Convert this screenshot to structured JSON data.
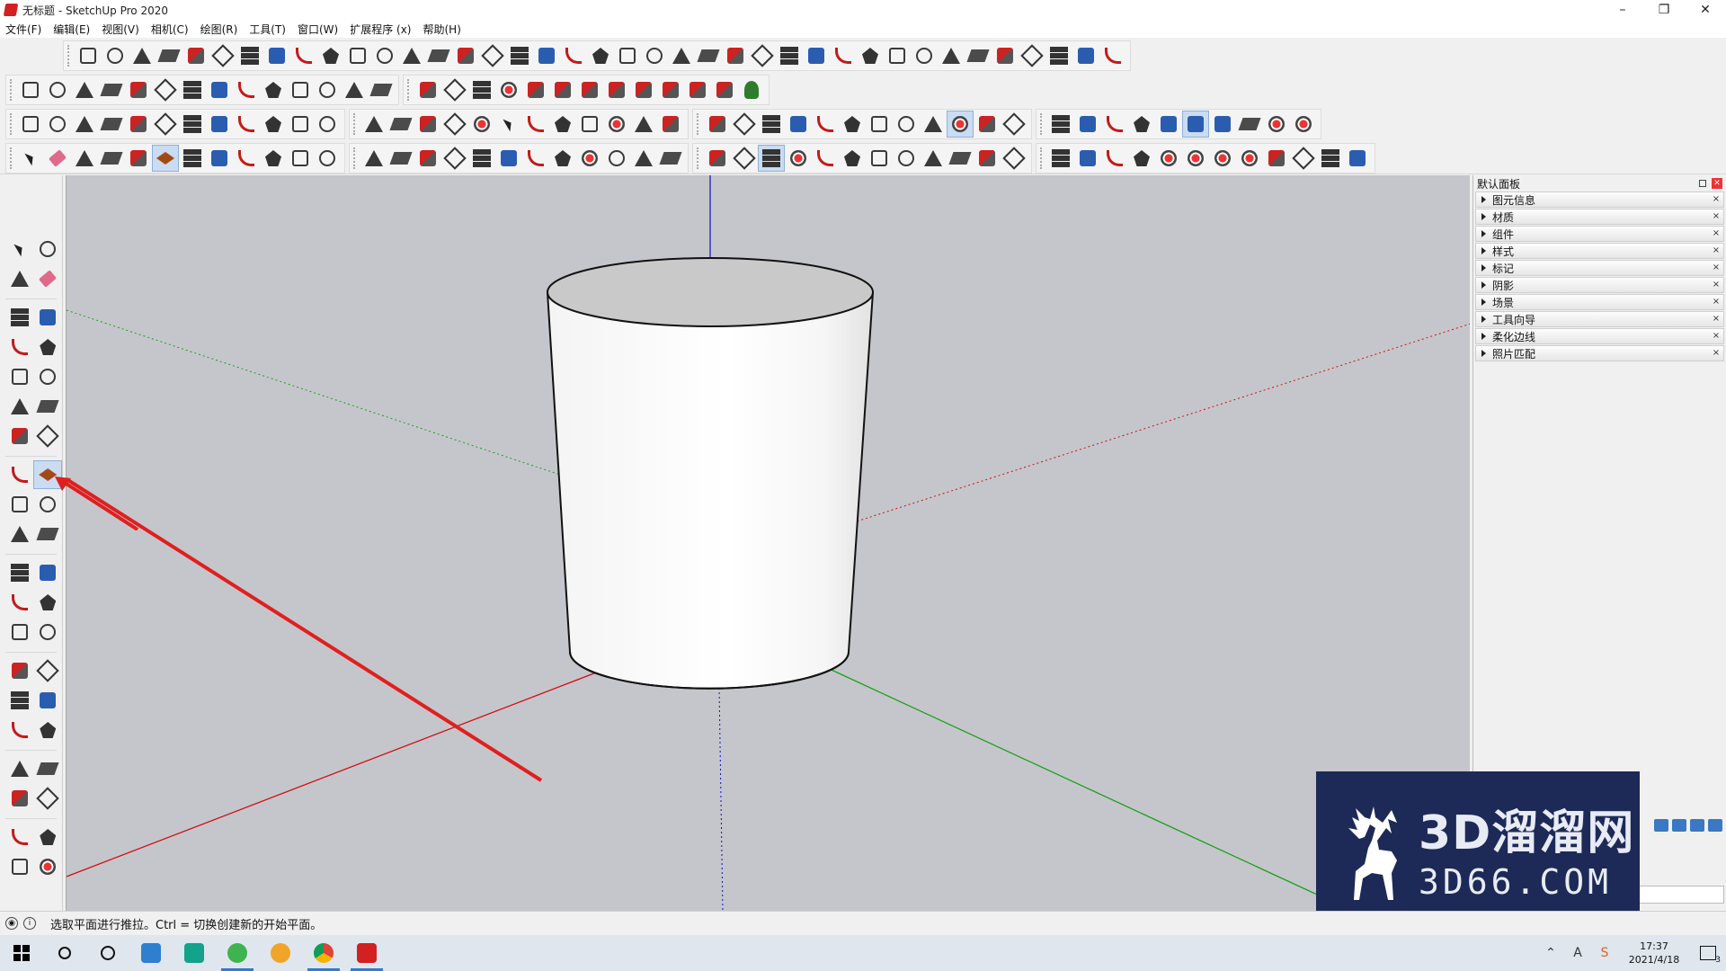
{
  "window": {
    "title": "无标题 - SketchUp Pro 2020",
    "minimize": "–",
    "restore": "❐",
    "close": "✕"
  },
  "menu": [
    "文件(F)",
    "编辑(E)",
    "视图(V)",
    "相机(C)",
    "绘图(R)",
    "工具(T)",
    "窗口(W)",
    "扩展程序 (x)",
    "帮助(H)"
  ],
  "toolbars": {
    "row1_icons": [
      "draw-icon",
      "polyline-icon",
      "shape-icon",
      "cut-icon",
      "gear-shape-icon",
      "bevel-icon",
      "sweep-icon",
      "box-icon",
      "sphere-icon",
      "curve-icon",
      "fillet-icon",
      "chamfer-icon",
      "offset-icon",
      "join-icon",
      "tube-icon",
      "cone-icon",
      "column-icon",
      "array-icon",
      "hand-icon",
      "extrude-icon",
      "path-icon",
      "loft-icon",
      "slice-icon",
      "skew-icon",
      "scale-icon",
      "mirror-icon",
      "stamp-icon",
      "solid-icon",
      "rail-icon",
      "grid-icon",
      "split-icon",
      "shell-icon",
      "fold-icon",
      "stairs-icon",
      "wall-icon",
      "twist-icon",
      "cage-icon",
      "lattice-icon",
      "building-icon"
    ],
    "row2_icons": [
      "bezier-icon",
      "spline-icon",
      "curve-draw-icon",
      "freehand-icon",
      "arc-ext-icon",
      "circle-ext-icon",
      "rect-ext-icon",
      "polygon-ext-icon",
      "ellipse-ext-icon",
      "arc3-icon",
      "zigzag-icon",
      "spiral-icon",
      "arcs-icon",
      "line-ext-icon",
      "loop-icon",
      "tool-icon",
      "circle-small-icon",
      "shape-red-icon",
      "push-red-icon",
      "push-e-icon",
      "push-r-icon",
      "push-v-icon",
      "push-n-icon",
      "push-x-icon",
      "push-f-icon",
      "push-magenta-icon",
      "tree-icon"
    ],
    "row3_icons": [
      "orbit-icon",
      "zoom-icon",
      "zoom-window-icon",
      "zoom-extents-icon",
      "zoom-prev-icon",
      "pan-icon",
      "walk-icon",
      "look-icon",
      "footprints-icon",
      "section-icon",
      "section-fill-icon",
      "box-view-icon",
      "table-icon",
      "grid-view-icon",
      "rail-view-icon",
      "line-view-icon",
      "move-red-icon",
      "select-pointer-icon",
      "check-icon",
      "paint-view-icon",
      "diamond-icon",
      "cube-red-icon",
      "pin-icon",
      "push-down-icon",
      "follow-icon",
      "wave-icon",
      "dup-icon",
      "layer-icon",
      "copy-icon",
      "wall-view-icon",
      "knife-icon",
      "key-icon",
      "3b-icon",
      "red-disk-icon",
      "su-app-icon",
      "stack-icon",
      "stack2-icon",
      "stack3-icon",
      "stack4-icon",
      "axes-icon",
      "blue-cube-icon",
      "blue-cube2-icon",
      "blue-cube3-icon",
      "undo-view-icon",
      "ruby-icon",
      "ruby2-icon"
    ],
    "row4_icons": [
      "select-icon",
      "eraser-icon",
      "pencil-icon",
      "arc-icon",
      "circle-icon",
      "push-pull-icon",
      "follow-me-icon",
      "move-icon",
      "rotate-icon",
      "scale-icon",
      "tape-icon",
      "text-icon",
      "paint-icon",
      "orbit-icon",
      "pan-icon",
      "zoom-icon",
      "zoom-extents-icon",
      "warehouse-icon",
      "extension-icon",
      "share-icon",
      "ruby-gem-icon",
      "user-icon",
      "face-style-icon",
      "xray-icon",
      "wireframe-icon",
      "hidden-line-icon",
      "shaded-icon",
      "textured-icon",
      "monochrome-icon",
      "iso-icon",
      "top-icon",
      "front-icon",
      "right-icon",
      "back-icon",
      "left-icon",
      "group1-icon",
      "group2-icon",
      "group3-icon",
      "group4-icon",
      "group5-icon",
      "red1-icon",
      "red2-icon",
      "red3-icon",
      "red4-icon",
      "arc-style-icon",
      "shield-icon",
      "sandbox-icon",
      "terrain-icon"
    ]
  },
  "left_tools": [
    [
      "select-icon",
      "component-icon"
    ],
    [
      "paint-bucket-icon",
      "eraser-icon"
    ],
    [
      "sep"
    ],
    [
      "pencil-icon",
      "freehand-icon"
    ],
    [
      "rectangle-icon",
      "rotated-rect-icon"
    ],
    [
      "circle-icon",
      "polygon-icon"
    ],
    [
      "arc-icon",
      "two-point-arc-icon"
    ],
    [
      "three-point-arc-icon",
      "pie-icon"
    ],
    [
      "sep"
    ],
    [
      "move-icon",
      "push-pull-icon"
    ],
    [
      "rotate-icon",
      "follow-me-icon"
    ],
    [
      "scale-icon",
      "offset-icon"
    ],
    [
      "sep"
    ],
    [
      "tape-measure-icon",
      "dimension-icon"
    ],
    [
      "protractor-icon",
      "text-icon"
    ],
    [
      "axes-icon",
      "3d-text-icon"
    ],
    [
      "sep"
    ],
    [
      "orbit-icon",
      "pan-icon"
    ],
    [
      "zoom-icon",
      "zoom-window-icon"
    ],
    [
      "zoom-extents-icon",
      "previous-view-icon"
    ],
    [
      "sep"
    ],
    [
      "position-camera-icon",
      "look-around-icon"
    ],
    [
      "walk-icon",
      "section-plane-icon"
    ],
    [
      "sep"
    ],
    [
      "warehouse-icon",
      "extension-warehouse-icon"
    ],
    [
      "share-model-icon",
      "ruby-icon"
    ]
  ],
  "right_panel": {
    "title": "默认面板",
    "items": [
      "图元信息",
      "材质",
      "组件",
      "样式",
      "标记",
      "阴影",
      "场景",
      "工具向导",
      "柔化边线",
      "照片匹配"
    ]
  },
  "watermark": {
    "main": "3D溜溜网",
    "sub": "3D66.COM"
  },
  "status": {
    "text": "选取平面进行推拉。Ctrl = 切换创建新的开始平面。"
  },
  "taskbar": {
    "time": "17:37",
    "date": "2021/4/18",
    "notifications": "3"
  },
  "colors": {
    "viewport": "#c5c6cb",
    "axis_red": "#d01010",
    "axis_green": "#1aa01a",
    "axis_blue": "#1010c0",
    "annotation_arrow": "#e01f1f",
    "watermark_bg": "#1d2a57"
  }
}
